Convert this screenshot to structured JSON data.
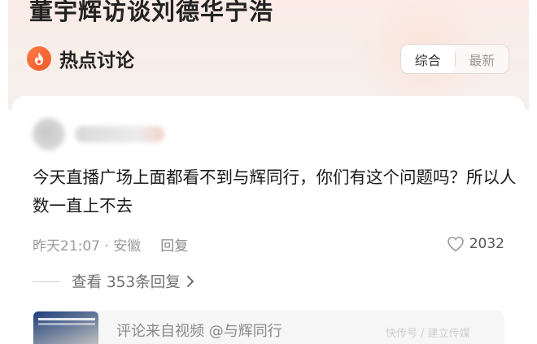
{
  "headline": "董宇辉访谈刘德华宁浩",
  "section": {
    "title": "热点讨论",
    "icon": "fire-icon"
  },
  "sort_tabs": [
    "综合",
    "最新"
  ],
  "sort_selected": "综合",
  "comment": {
    "text": "今天直播广场上面都看不到与辉同行，你们有这个问题吗？所以人数一直上不去",
    "time_location": "昨天21:07 · 安徽",
    "reply_label": "回复",
    "likes": "2032",
    "view_replies": "查看 353条回复"
  },
  "source": {
    "text": "评论来自视频 @与辉同行"
  },
  "watermark": "快传号 / 建立传媒",
  "colors": {
    "accent": "#f05a28",
    "bg_top": "#fbece7"
  }
}
